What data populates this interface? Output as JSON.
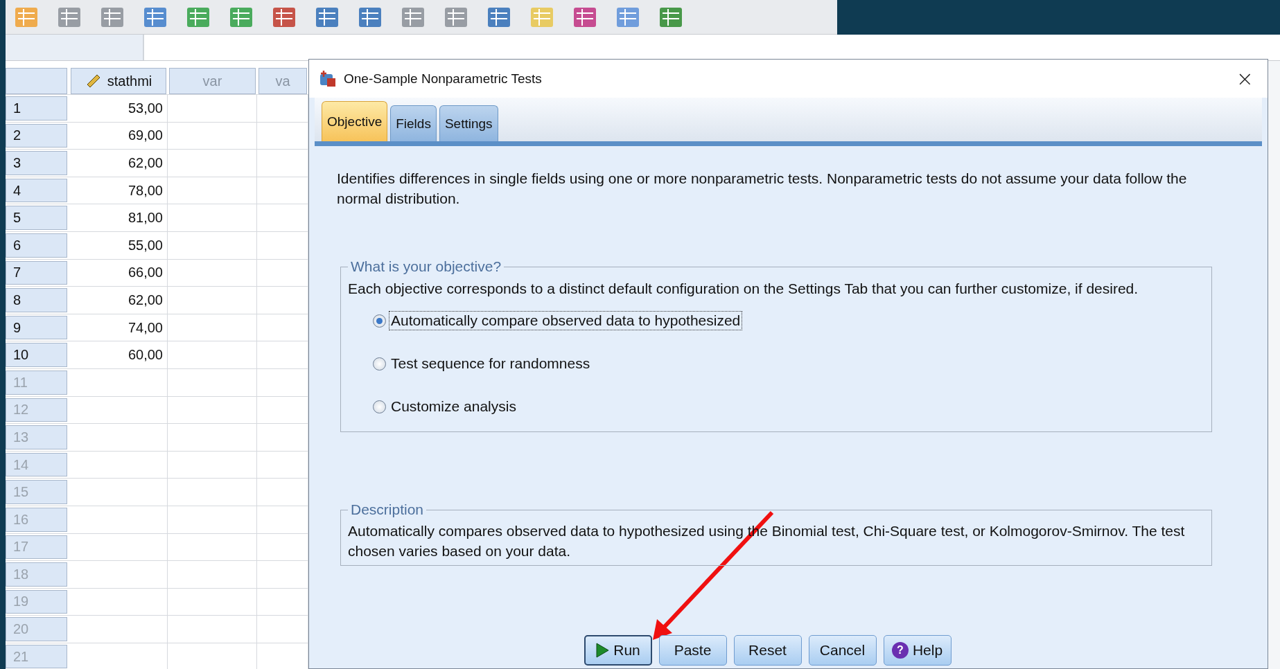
{
  "grid": {
    "columns": [
      "stathmi",
      "var",
      "va"
    ],
    "rows": [
      {
        "number": "1",
        "value": "53,00"
      },
      {
        "number": "2",
        "value": "69,00"
      },
      {
        "number": "3",
        "value": "62,00"
      },
      {
        "number": "4",
        "value": "78,00"
      },
      {
        "number": "5",
        "value": "81,00"
      },
      {
        "number": "6",
        "value": "55,00"
      },
      {
        "number": "7",
        "value": "66,00"
      },
      {
        "number": "8",
        "value": "62,00"
      },
      {
        "number": "9",
        "value": "74,00"
      },
      {
        "number": "10",
        "value": "60,00"
      },
      {
        "number": "11"
      },
      {
        "number": "12"
      },
      {
        "number": "13"
      },
      {
        "number": "14"
      },
      {
        "number": "15"
      },
      {
        "number": "16"
      },
      {
        "number": "17"
      },
      {
        "number": "18"
      },
      {
        "number": "19"
      },
      {
        "number": "20"
      },
      {
        "number": "21"
      }
    ]
  },
  "dialog": {
    "title": "One-Sample Nonparametric Tests",
    "close": "×",
    "tabs": [
      {
        "label": "Objective",
        "selected": true
      },
      {
        "label": "Fields",
        "selected": false
      },
      {
        "label": "Settings",
        "selected": false
      }
    ],
    "intro": "Identifies differences in single fields using one or more nonparametric tests. Nonparametric tests do not assume your data follow the normal distribution.",
    "objective": {
      "legend": "What is your objective?",
      "hint": "Each objective corresponds to a distinct default configuration on the Settings Tab that you can further customize, if desired.",
      "options": [
        {
          "label": "Automatically compare observed data to hypothesized",
          "selected": true
        },
        {
          "label": "Test sequence for randomness",
          "selected": false
        },
        {
          "label": "Customize analysis",
          "selected": false
        }
      ]
    },
    "description": {
      "legend": "Description",
      "text": "Automatically compares observed data to hypothesized using the Binomial test, Chi-Square test, or Kolmogorov-Smirnov.  The test chosen varies based on your data."
    },
    "buttons": [
      {
        "kind": "run",
        "label": "Run"
      },
      {
        "kind": "plain",
        "label": "Paste"
      },
      {
        "kind": "plain",
        "label": "Reset"
      },
      {
        "kind": "plain",
        "label": "Cancel"
      },
      {
        "kind": "help",
        "label": "Help",
        "icon_glyph": "?"
      }
    ]
  }
}
